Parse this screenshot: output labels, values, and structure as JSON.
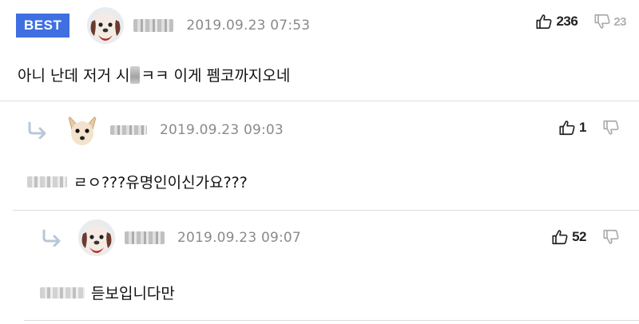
{
  "comments": [
    {
      "badge": "BEST",
      "timestamp": "2019.09.23 07:53",
      "upvotes": "236",
      "downvotes": "23",
      "text_before": "아니 난데 저거 시",
      "text_after": "ㅋㅋ 이게 펨코까지오네",
      "avatar": "dog-face-icon"
    },
    {
      "timestamp": "2019.09.23 09:03",
      "upvotes": "1",
      "downvotes": "",
      "text": "ㄹㅇ???유명인이신가요???",
      "avatar": "chihuahua-face-icon"
    },
    {
      "timestamp": "2019.09.23 09:07",
      "upvotes": "52",
      "downvotes": "",
      "text": "듣보입니다만",
      "avatar": "dog-face-icon"
    }
  ],
  "colors": {
    "badge": "#3f6fe0",
    "timestamp": "#8a8a8a",
    "divider": "#dcdcdc"
  }
}
